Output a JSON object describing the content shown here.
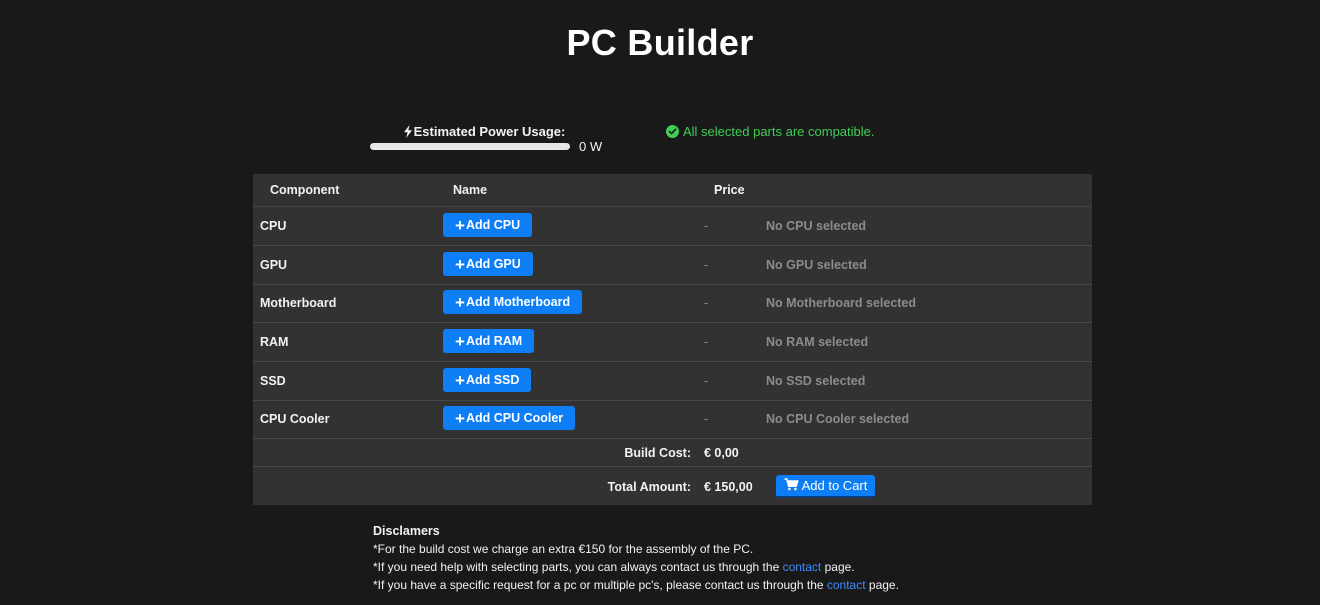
{
  "page": {
    "title": "PC Builder"
  },
  "power": {
    "label": "Estimated Power Usage:",
    "value": "0 W",
    "fill_fraction": 0,
    "icon": "lightning-bolt-icon"
  },
  "compatibility": {
    "message": "All selected parts are compatible.",
    "icon": "check-circle-icon",
    "color": "#3fcf55"
  },
  "table": {
    "headers": {
      "component": "Component",
      "name": "Name",
      "price": "Price"
    },
    "rows": [
      {
        "component": "CPU",
        "button": "Add CPU",
        "price": "-",
        "status": "No CPU selected"
      },
      {
        "component": "GPU",
        "button": "Add GPU",
        "price": "-",
        "status": "No GPU selected"
      },
      {
        "component": "Motherboard",
        "button": "Add Motherboard",
        "price": "-",
        "status": "No Motherboard selected"
      },
      {
        "component": "RAM",
        "button": "Add RAM",
        "price": "-",
        "status": "No RAM selected"
      },
      {
        "component": "SSD",
        "button": "Add SSD",
        "price": "-",
        "status": "No SSD selected"
      },
      {
        "component": "CPU Cooler",
        "button": "Add CPU Cooler",
        "price": "-",
        "status": "No CPU Cooler selected"
      }
    ],
    "build_cost": {
      "label": "Build Cost:",
      "value": "€ 0,00"
    },
    "total": {
      "label": "Total Amount:",
      "value": "€ 150,00"
    },
    "cart_button": {
      "label": "Add to Cart",
      "icon": "shopping-cart-icon"
    }
  },
  "disclaimers": {
    "heading": "Disclamers",
    "line1": "*For the build cost we charge an extra €150 for the assembly of the PC.",
    "line2_pre": "*If you need help with selecting parts, you can always contact us through the ",
    "line2_link": "contact",
    "line2_post": " page.",
    "line3_pre": "*If you have a specific request for a pc or multiple pc's, please contact us through the ",
    "line3_link": "contact",
    "line3_post": " page."
  },
  "colors": {
    "background": "#191919",
    "table_bg": "#323232",
    "button_blue": "#0d7ef5",
    "link_blue": "#3d8bff"
  }
}
